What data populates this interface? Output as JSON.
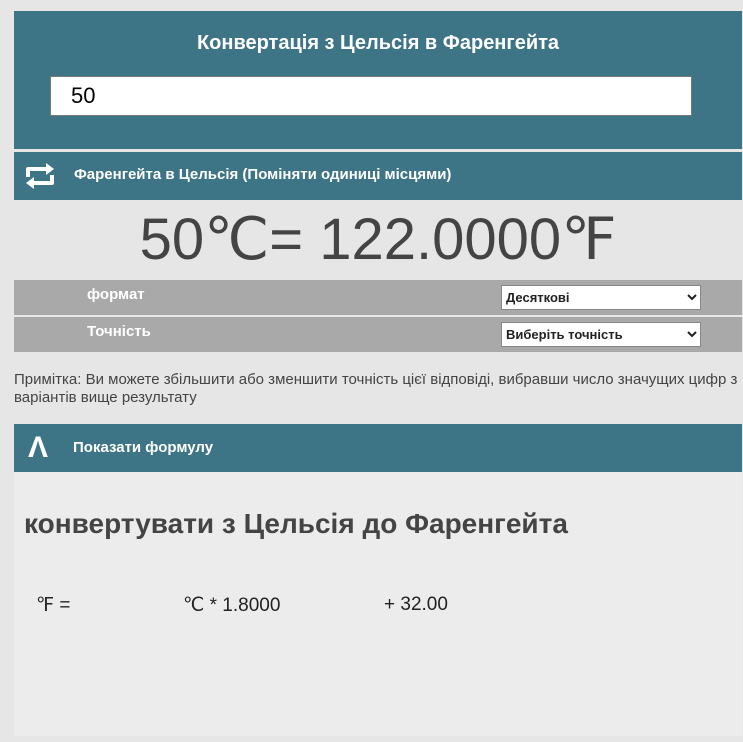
{
  "header": {
    "title": "Конвертація з Цельсія в Фаренгейта",
    "input_value": "50"
  },
  "swap": {
    "label": "Фаренгейта в Цельсія (Поміняти одиниці місцями)"
  },
  "result": {
    "input_value": "50",
    "input_unit": "℃",
    "equals": "=",
    "output_value": "122.0000",
    "output_unit": "℉"
  },
  "options": {
    "format_label": "формат",
    "format_selected": "Десяткові",
    "precision_label": "Точність",
    "precision_selected": "Виберіть точність"
  },
  "note": "Примітка: Ви можете збільшити або зменшити точність цієї відповіді, вибравши число значущих цифр з варіантів вище результату",
  "formula_toggle": {
    "icon": "Λ",
    "label": "Показати формулу"
  },
  "formula": {
    "heading": "конвертувати з Цельсія до Фаренгейта",
    "lhs_unit": "℉",
    "lhs_eq": " =",
    "rhs_unit": "℃",
    "rhs_mult": " * 1.8000",
    "rhs_add": "+ 32.00"
  },
  "colors": {
    "bar": "#3d7587",
    "option_row": "#a9a9a9",
    "background": "#e6e6e6"
  }
}
